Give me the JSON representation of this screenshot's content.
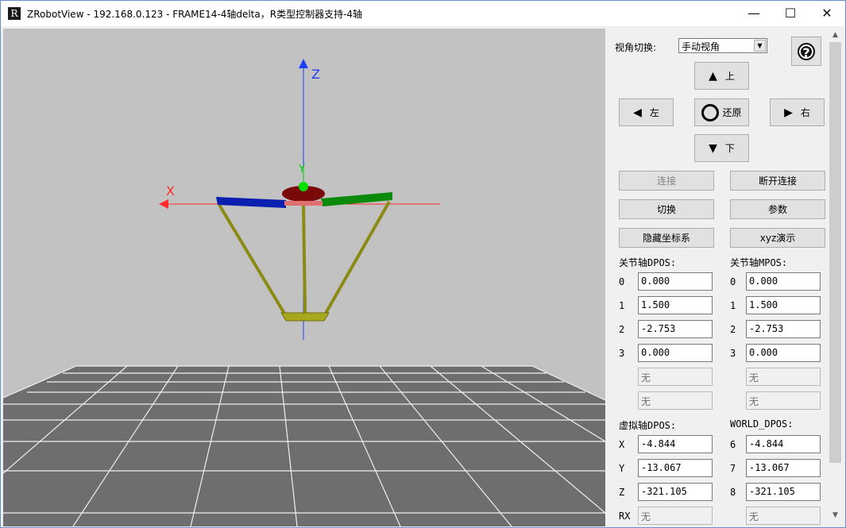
{
  "window": {
    "title": "ZRobotView - 192.168.0.123 - FRAME14-4轴delta，R类型控制器支持-4轴",
    "icon_letter": "R",
    "minimize": "—",
    "maximize": "☐",
    "close": "✕"
  },
  "viewport": {
    "axis_labels": {
      "z": "Z",
      "x": "X",
      "y": "Y"
    },
    "colors": {
      "background": "#c2c2c2",
      "z_axis": "#1f3fff",
      "x_axis": "#ff2a2a",
      "y_axis": "#00d000",
      "arm_left": "#0a1eb0",
      "arm_right": "#0c8a0c",
      "hub": "#7a0a0a",
      "linkage": "#8a8a14",
      "floor": "#6e6e6e",
      "grid_line": "#f0f0f0"
    }
  },
  "panel": {
    "view_switch_label": "视角切换:",
    "view_mode_value": "手动视角",
    "help_icon": "?",
    "nav": {
      "up": "上",
      "left": "左",
      "reset": "还原",
      "right": "右",
      "down": "下"
    },
    "buttons": {
      "connect": "连接",
      "disconnect": "断开连接",
      "switch": "切换",
      "params": "参数",
      "hide_coords": "隐藏坐标系",
      "xyz_demo": "xyz演示"
    },
    "joint_dpos_label": "关节轴DPOS:",
    "joint_mpos_label": "关节轴MPOS:",
    "joint_dpos": [
      {
        "idx": "0",
        "value": "0.000"
      },
      {
        "idx": "1",
        "value": "1.500"
      },
      {
        "idx": "2",
        "value": "-2.753"
      },
      {
        "idx": "3",
        "value": "0.000"
      }
    ],
    "joint_mpos": [
      {
        "idx": "0",
        "value": "0.000"
      },
      {
        "idx": "1",
        "value": "1.500"
      },
      {
        "idx": "2",
        "value": "-2.753"
      },
      {
        "idx": "3",
        "value": "0.000"
      }
    ],
    "none_value": "无",
    "virtual_dpos_label": "虚拟轴DPOS:",
    "world_dpos_label": "WORLD_DPOS:",
    "virtual_dpos": [
      {
        "idx": "X",
        "value": "-4.844"
      },
      {
        "idx": "Y",
        "value": "-13.067"
      },
      {
        "idx": "Z",
        "value": "-321.105"
      },
      {
        "idx": "RX",
        "value": "无"
      }
    ],
    "world_dpos": [
      {
        "idx": "6",
        "value": "-4.844"
      },
      {
        "idx": "7",
        "value": "-13.067"
      },
      {
        "idx": "8",
        "value": "-321.105"
      },
      {
        "idx": "",
        "value": "无"
      }
    ]
  }
}
